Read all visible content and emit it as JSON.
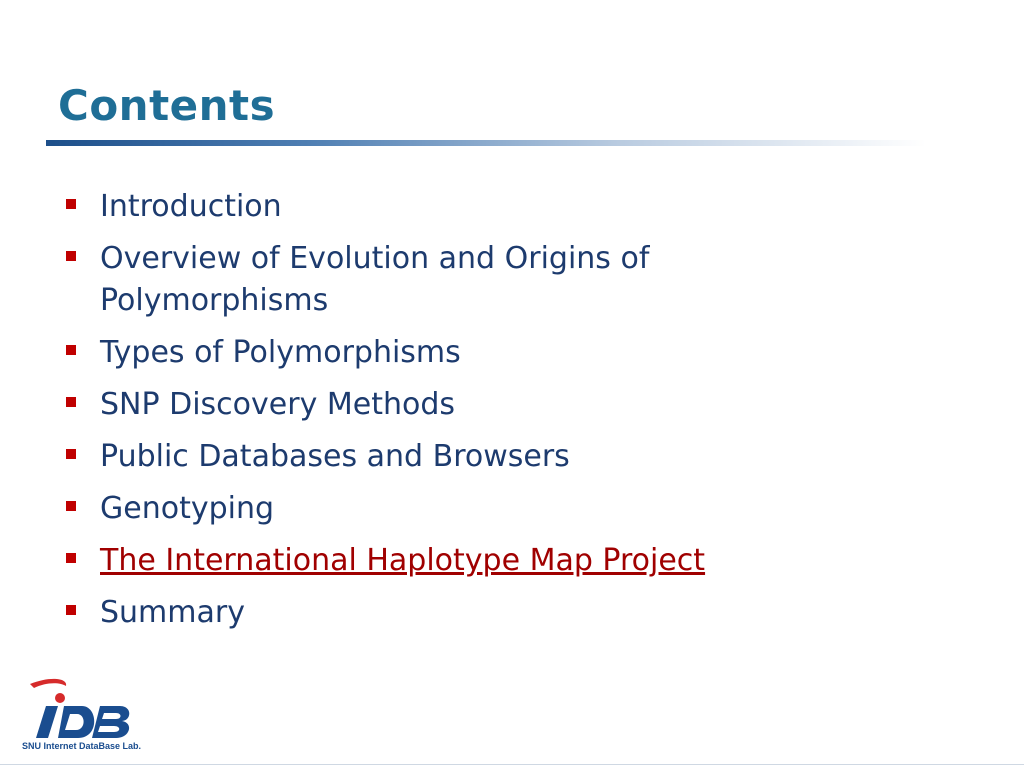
{
  "slide": {
    "title": "Contents",
    "items": [
      {
        "label": "Introduction",
        "link": false
      },
      {
        "label": "Overview of Evolution and Origins of Polymorphisms",
        "link": false
      },
      {
        "label": "Types of Polymorphisms",
        "link": false
      },
      {
        "label": "SNP Discovery Methods",
        "link": false
      },
      {
        "label": "Public Databases and Browsers",
        "link": false
      },
      {
        "label": "Genotyping",
        "link": false
      },
      {
        "label": "The International Haplotype Map Project",
        "link": true
      },
      {
        "label": "Summary",
        "link": false
      }
    ]
  },
  "logo": {
    "caption": "SNU Internet DataBase Lab.",
    "mark_lettering": "iDB"
  },
  "colors": {
    "title": "#1f6e96",
    "body_text": "#1d3b6e",
    "bullet": "#c00000",
    "link": "#a00000"
  }
}
